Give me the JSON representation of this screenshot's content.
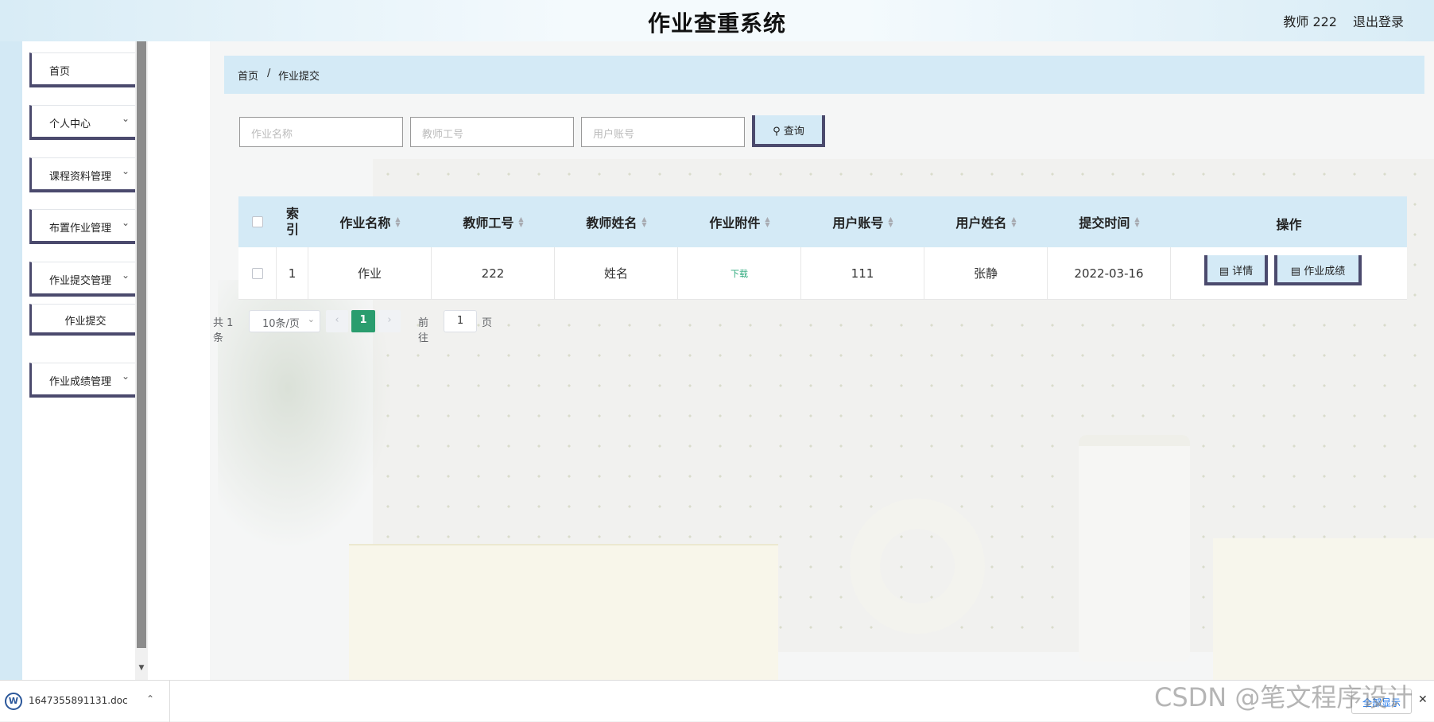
{
  "header": {
    "title": "作业查重系统",
    "user": "教师 222",
    "logout": "退出登录"
  },
  "sidebar": {
    "items": [
      {
        "label": "首页"
      },
      {
        "label": "个人中心"
      },
      {
        "label": "课程资料管理"
      },
      {
        "label": "布置作业管理"
      },
      {
        "label": "作业提交管理"
      },
      {
        "label": "作业成绩管理"
      }
    ],
    "subitem": "作业提交"
  },
  "breadcrumb": {
    "home": "首页",
    "sep": "/",
    "current": "作业提交"
  },
  "search": {
    "name_placeholder": "作业名称",
    "teacher_placeholder": "教师工号",
    "user_placeholder": "用户账号",
    "button": "查询"
  },
  "table": {
    "headers": [
      "索引",
      "作业名称",
      "教师工号",
      "教师姓名",
      "作业附件",
      "用户账号",
      "用户姓名",
      "提交时间",
      "操作"
    ],
    "rows": [
      {
        "index": "1",
        "name": "作业",
        "teacher_id": "222",
        "teacher_name": "姓名",
        "attachment": "下载",
        "user_account": "111",
        "user_name": "张静",
        "time": "2022-03-16",
        "detail": "详情",
        "grade": "作业成绩"
      }
    ]
  },
  "pager": {
    "total": "共 1 条",
    "size": "10条/页",
    "page": "1",
    "goto": "前往",
    "goto_value": "1",
    "unit": "页"
  },
  "download_bar": {
    "file": "1647355891131.doc",
    "show_all": "全部显示"
  },
  "watermark": "CSDN @笔文程序设计"
}
